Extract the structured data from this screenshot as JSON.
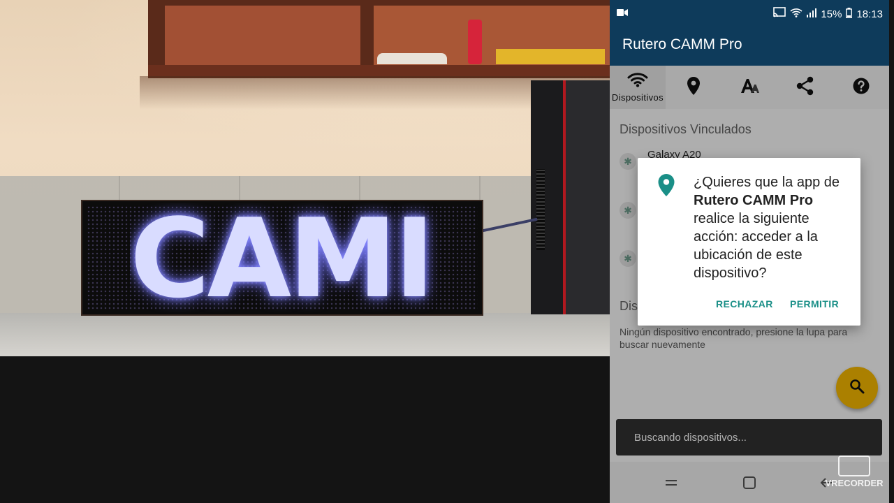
{
  "status_bar": {
    "battery": "15%",
    "time": "18:13"
  },
  "app_bar": {
    "title": "Rutero CAMM Pro"
  },
  "tabs": [
    {
      "name": "devices",
      "label": "Dispositivos",
      "icon": "wifi-icon",
      "active": true
    },
    {
      "name": "location",
      "label": "",
      "icon": "location-pin-icon"
    },
    {
      "name": "text",
      "label": "",
      "icon": "text-format-icon"
    },
    {
      "name": "share",
      "label": "",
      "icon": "share-icon"
    },
    {
      "name": "help",
      "label": "",
      "icon": "help-icon"
    }
  ],
  "paired": {
    "title": "Dispositivos Vinculados",
    "devices": [
      {
        "name": "Galaxy A20"
      },
      {
        "name": ""
      },
      {
        "name": ""
      }
    ]
  },
  "discovered": {
    "title_visible": "Dis",
    "empty_message": "Ningún dispositivo encontrado, presione la lupa para buscar nuevamente"
  },
  "fab": {
    "icon": "search-icon",
    "color": "#F5B800"
  },
  "snackbar": {
    "text": "Buscando dispositivos..."
  },
  "dialog": {
    "icon": "location-pin-icon",
    "text_part1": "¿Quieres que la app de ",
    "text_app": "Rutero CAMM Pro",
    "text_part2": " realice la siguiente acción: acceder a la ubicación de este dispositivo?",
    "deny_label": "RECHAZAR",
    "allow_label": "PERMITIR",
    "accent": "#1A8F87"
  },
  "scene": {
    "led_text": "CAMI"
  },
  "watermark": {
    "text": "VRECORDER"
  },
  "colors": {
    "app_bar": "#0E3B5B",
    "accent": "#1A8F87"
  }
}
